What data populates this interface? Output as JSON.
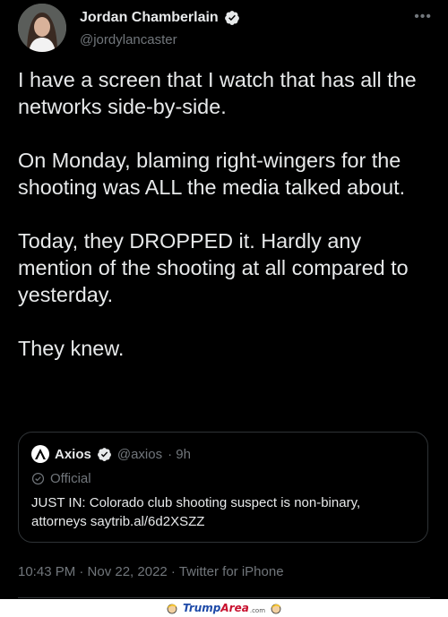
{
  "author": {
    "name": "Jordan Chamberlain",
    "handle": "@jordylancaster",
    "verified": true,
    "avatar_icon": "avatar-photo"
  },
  "tweet": {
    "paragraphs": [
      "I have a screen that I watch that has all the networks side-by-side.",
      "On Monday, blaming right-wingers for the shooting was ALL the media talked about.",
      "Today, they DROPPED it. Hardly any mention of the shooting at all compared to yesterday.",
      "They knew."
    ],
    "meta": "10:43 PM · Nov 22, 2022 · Twitter for iPhone"
  },
  "quote": {
    "name": "Axios",
    "handle": "@axios",
    "time": "· 9h",
    "label": "Official",
    "text": "JUST IN: Colorado club shooting suspect is non-binary, attorneys saytrib.al/6d2XSZZ"
  },
  "watermark": {
    "text_a": "Trump",
    "text_b": "Area",
    "suffix": ".com"
  },
  "colors": {
    "background": "#000000",
    "text": "#e7e9ea",
    "secondary": "#71767b",
    "verified": "#e7e9ea"
  }
}
